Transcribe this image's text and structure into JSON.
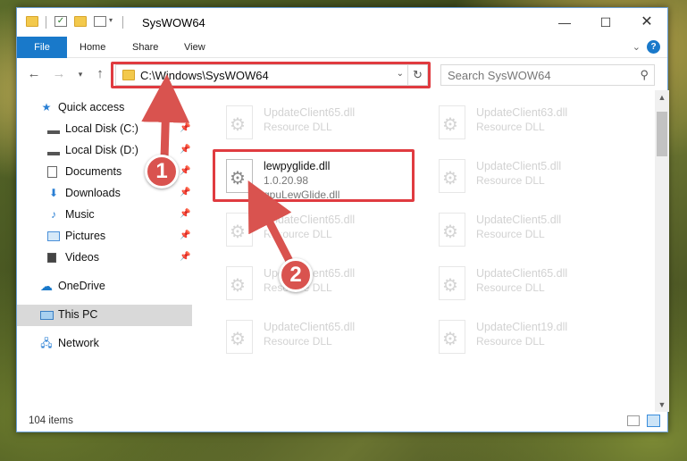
{
  "window": {
    "title": "SysWOW64"
  },
  "ribbon": {
    "tabs": [
      "File",
      "Home",
      "Share",
      "View"
    ],
    "help": "?"
  },
  "address": {
    "path": "C:\\Windows\\SysWOW64",
    "search_placeholder": "Search SysWOW64"
  },
  "nav": {
    "items": [
      {
        "label": "Quick access",
        "icon": "star-icon"
      },
      {
        "label": "Local Disk (C:)",
        "icon": "drive-icon"
      },
      {
        "label": "Local Disk (D:)",
        "icon": "drive-icon"
      },
      {
        "label": "Documents",
        "icon": "documents-icon"
      },
      {
        "label": "Downloads",
        "icon": "download-icon"
      },
      {
        "label": "Music",
        "icon": "music-icon"
      },
      {
        "label": "Pictures",
        "icon": "pictures-icon"
      },
      {
        "label": "Videos",
        "icon": "videos-icon"
      },
      {
        "label": "OneDrive",
        "icon": "cloud-icon"
      },
      {
        "label": "This PC",
        "icon": "computer-icon"
      },
      {
        "label": "Network",
        "icon": "network-icon"
      }
    ]
  },
  "files": [
    {
      "name": "UpdateClient65.dll",
      "line2": "Resource DLL",
      "line3": ""
    },
    {
      "name": "UpdateClient63.dll",
      "line2": "Resource DLL",
      "line3": ""
    },
    {
      "name": "lewpyglide.dll",
      "line2": "1.0.20.98",
      "line3": "gpuLewGlide.dll"
    },
    {
      "name": "UpdateClient5.dll",
      "line2": "Resource DLL",
      "line3": ""
    },
    {
      "name": "UpdateClient65.dll",
      "line2": "Resource DLL",
      "line3": ""
    },
    {
      "name": "UpdateClient5.dll",
      "line2": "Resource DLL",
      "line3": ""
    },
    {
      "name": "UpdateClient65.dll",
      "line2": "Resource DLL",
      "line3": ""
    },
    {
      "name": "UpdateClient65.dll",
      "line2": "Resource DLL",
      "line3": ""
    },
    {
      "name": "UpdateClient65.dll",
      "line2": "Resource DLL",
      "line3": ""
    },
    {
      "name": "UpdateClient19.dll",
      "line2": "Resource DLL",
      "line3": ""
    }
  ],
  "status": {
    "item_count": "104 items"
  },
  "annotations": {
    "badge1": "1",
    "badge2": "2"
  },
  "colors": {
    "accent": "#1979ca",
    "highlight": "#e03b40",
    "badge": "#d9534f"
  }
}
